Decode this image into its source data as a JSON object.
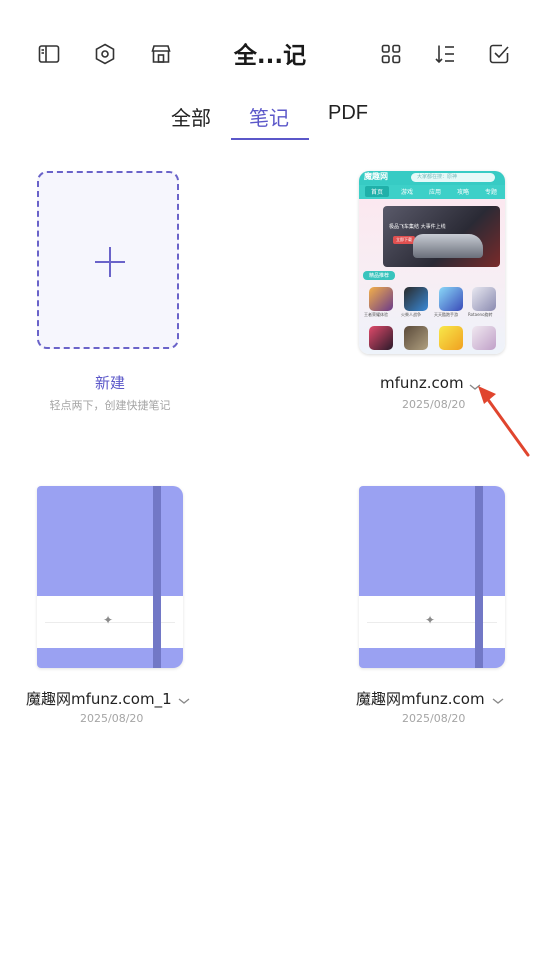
{
  "header": {
    "title": "全...记",
    "icons": [
      "sidebar-icon",
      "settings-icon",
      "store-icon",
      "grid-icon",
      "sort-icon",
      "check-icon"
    ]
  },
  "tabs": [
    {
      "label": "全部",
      "active": false
    },
    {
      "label": "笔记",
      "active": true
    },
    {
      "label": "PDF",
      "active": false
    }
  ],
  "new_card": {
    "label": "新建",
    "hint": "轻点两下，创建快捷笔记"
  },
  "thumbnail": {
    "logo": "魔趣网",
    "search": "大家都在搜：原神",
    "nav": [
      "首页",
      "游戏",
      "应用",
      "攻略",
      "专题"
    ],
    "banner_text": "极品飞车集结 大事件上线",
    "banner_button": "立即下载",
    "section": "精品推荐",
    "apps": [
      "王者荣耀体验",
      "火柴人战争",
      "天天酷跑手游",
      "Rotaeno旋转"
    ]
  },
  "items": [
    {
      "title": "mfunz.com",
      "date": "2025/08/20"
    },
    {
      "title": "魔趣网mfunz.com_1",
      "date": "2025/08/20"
    },
    {
      "title": "魔趣网mfunz.com",
      "date": "2025/08/20"
    }
  ],
  "colors": {
    "accent": "#5b57c9",
    "notebook": "#9aa1f2",
    "annotation_arrow": "#e0452e"
  }
}
